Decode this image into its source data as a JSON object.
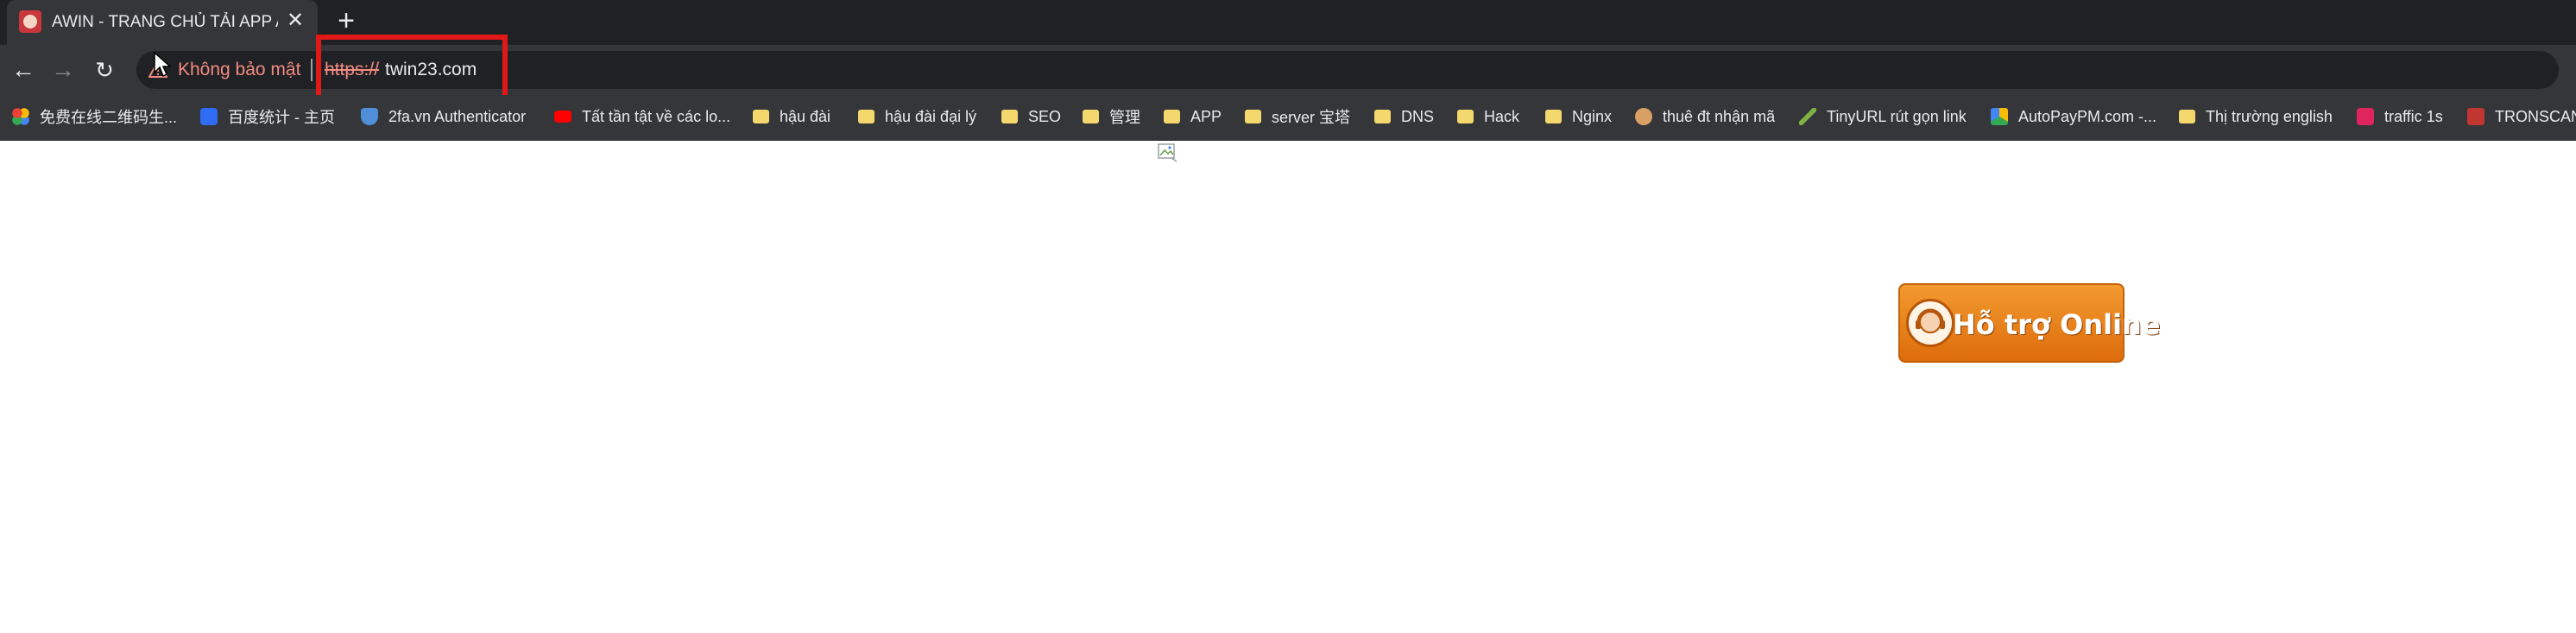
{
  "tab": {
    "title": "AWIN - TRANG CHỦ TẢI APP AW",
    "close_glyph": "✕",
    "new_tab_glyph": "+"
  },
  "toolbar": {
    "back_glyph": "←",
    "forward_glyph": "→",
    "reload_glyph": "↻",
    "security_label": "Không bảo mật",
    "url_scheme": "https://",
    "url_host": "twin23.com"
  },
  "bookmarks": [
    {
      "label": "免费在线二维码生...",
      "icon": "colorful-dots-icon",
      "color": "#ea4335"
    },
    {
      "label": "百度统计 - 主页",
      "icon": "baidu-icon",
      "color": "#2d6cf3"
    },
    {
      "label": "2fa.vn Authenticator",
      "icon": "shield-icon",
      "color": "#4f8ed9"
    },
    {
      "label": "Tất tần tật về các lo...",
      "icon": "youtube-icon",
      "color": "#ff0000"
    },
    {
      "label": "hậu đài",
      "icon": "folder-icon",
      "color": "#f4d86d"
    },
    {
      "label": "hậu đài đại lý",
      "icon": "folder-icon",
      "color": "#f4d86d"
    },
    {
      "label": "SEO",
      "icon": "folder-icon",
      "color": "#f4d86d"
    },
    {
      "label": "管理",
      "icon": "folder-icon",
      "color": "#f4d86d"
    },
    {
      "label": "APP",
      "icon": "folder-icon",
      "color": "#f4d86d"
    },
    {
      "label": "server 宝塔",
      "icon": "folder-icon",
      "color": "#f4d86d"
    },
    {
      "label": "DNS",
      "icon": "folder-icon",
      "color": "#f4d86d"
    },
    {
      "label": "Hack",
      "icon": "folder-icon",
      "color": "#f4d86d"
    },
    {
      "label": "Nginx",
      "icon": "folder-icon",
      "color": "#f4d86d"
    },
    {
      "label": "thuê đt nhận mã",
      "icon": "agent-icon",
      "color": "#d9a066"
    },
    {
      "label": "TinyURL rút gọn link",
      "icon": "tinyurl-icon",
      "color": "#7cb342"
    },
    {
      "label": "AutoPayPM.com -...",
      "icon": "drive-icon",
      "color": "#34a853"
    },
    {
      "label": "Thị trường english",
      "icon": "folder-icon",
      "color": "#f4d86d"
    },
    {
      "label": "traffic 1s",
      "icon": "traffic-icon",
      "color": "#e0245e"
    },
    {
      "label": "TRONSCAN",
      "icon": "tronscan-icon",
      "color": "#c23631"
    }
  ],
  "page": {
    "support_button_label": "Hỗ trợ Online"
  },
  "colors": {
    "highlight": "#e01818",
    "warning": "#f28b82",
    "support_orange": "#f39a2f"
  }
}
